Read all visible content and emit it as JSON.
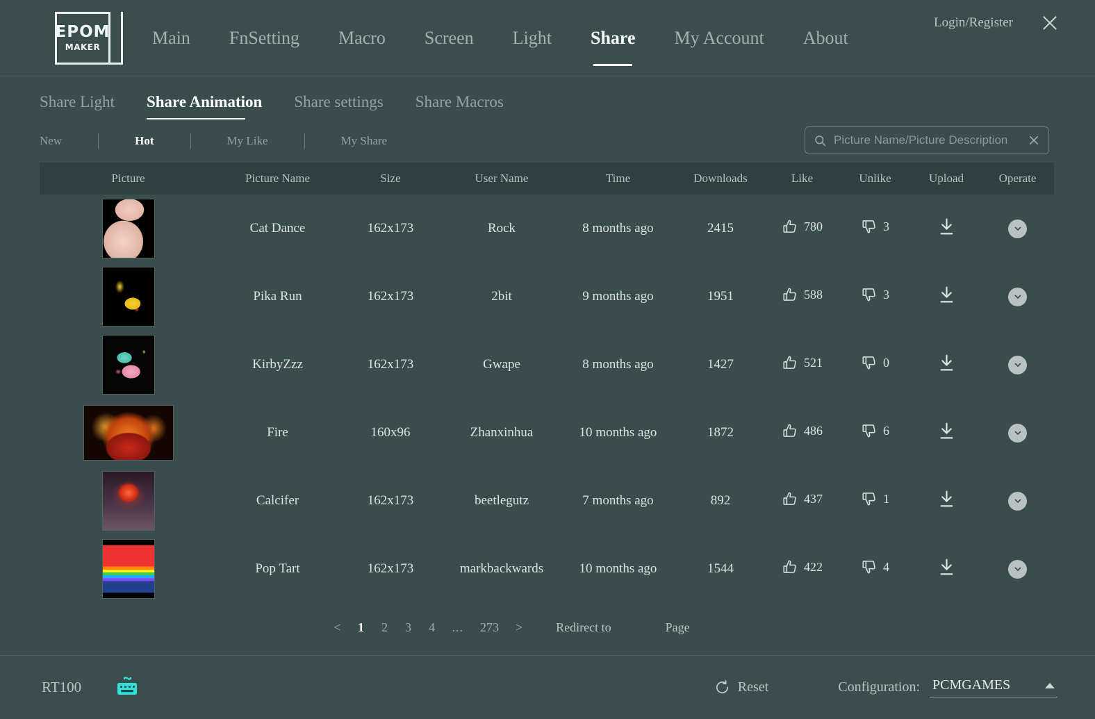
{
  "window": {
    "logo_text_top": "EPOM",
    "logo_text_bottom": "MAKER",
    "login_label": "Login/Register",
    "close_icon": "close-icon"
  },
  "main_nav": {
    "items": [
      {
        "label": "Main",
        "active": false
      },
      {
        "label": "FnSetting",
        "active": false
      },
      {
        "label": "Macro",
        "active": false
      },
      {
        "label": "Screen",
        "active": false
      },
      {
        "label": "Light",
        "active": false
      },
      {
        "label": "Share",
        "active": true
      },
      {
        "label": "My Account",
        "active": false
      },
      {
        "label": "About",
        "active": false
      }
    ]
  },
  "sub_tabs": {
    "items": [
      {
        "label": "Share Light",
        "active": false
      },
      {
        "label": "Share Animation",
        "active": true
      },
      {
        "label": "Share settings",
        "active": false
      },
      {
        "label": "Share Macros",
        "active": false
      }
    ]
  },
  "filters": {
    "items": [
      {
        "label": "New",
        "active": false
      },
      {
        "label": "Hot",
        "active": true
      },
      {
        "label": "My Like",
        "active": false
      },
      {
        "label": "My Share",
        "active": false
      }
    ]
  },
  "search": {
    "placeholder": "Picture Name/Picture Description",
    "value": "",
    "search_icon": "search-icon",
    "clear_icon": "clear-icon"
  },
  "table": {
    "headers": [
      "Picture",
      "Picture Name",
      "Size",
      "User Name",
      "Time",
      "Downloads",
      "Like",
      "Unlike",
      "Upload",
      "Operate"
    ],
    "rows": [
      {
        "thumb_class": "tb-cat",
        "thumb_wide": false,
        "name": "Cat Dance",
        "size": "162x173",
        "user": "Rock",
        "time": "8 months ago",
        "downloads": "2415",
        "like": "780",
        "unlike": "3"
      },
      {
        "thumb_class": "tb-pika",
        "thumb_wide": false,
        "name": "Pika Run",
        "size": "162x173",
        "user": "2bit",
        "time": "9 months ago",
        "downloads": "1951",
        "like": "588",
        "unlike": "3"
      },
      {
        "thumb_class": "tb-kirby",
        "thumb_wide": false,
        "name": "KirbyZzz",
        "size": "162x173",
        "user": "Gwape",
        "time": "8 months ago",
        "downloads": "1427",
        "like": "521",
        "unlike": "0"
      },
      {
        "thumb_class": "tb-fire",
        "thumb_wide": true,
        "name": "Fire",
        "size": "160x96",
        "user": "Zhanxinhua",
        "time": "10 months ago",
        "downloads": "1872",
        "like": "486",
        "unlike": "6"
      },
      {
        "thumb_class": "tb-calcifer",
        "thumb_wide": false,
        "name": "Calcifer",
        "size": "162x173",
        "user": "beetlegutz",
        "time": "7 months ago",
        "downloads": "892",
        "like": "437",
        "unlike": "1"
      },
      {
        "thumb_class": "tb-poptart",
        "thumb_wide": false,
        "name": "Pop Tart",
        "size": "162x173",
        "user": "markbackwards",
        "time": "10 months ago",
        "downloads": "1544",
        "like": "422",
        "unlike": "4"
      }
    ]
  },
  "pagination": {
    "prev": "<",
    "next": ">",
    "pages": [
      "1",
      "2",
      "3",
      "4",
      "...",
      "273"
    ],
    "current": "1",
    "redirect_label": "Redirect to",
    "redirect_value": "",
    "page_word": "Page"
  },
  "bottom": {
    "device": "RT100",
    "keyboard_icon": "keyboard-icon",
    "reset_label": "Reset",
    "reset_icon": "refresh-icon",
    "configuration_label": "Configuration:",
    "configuration_value": "PCMGAMES",
    "caret_icon": "caret-up-icon"
  },
  "colors": {
    "background": "#3a4d4d",
    "header_strip": "#2f4040",
    "accent_text": "#ffffff",
    "muted_text": "#93a1a1",
    "device_icon": "#2fe3da"
  }
}
